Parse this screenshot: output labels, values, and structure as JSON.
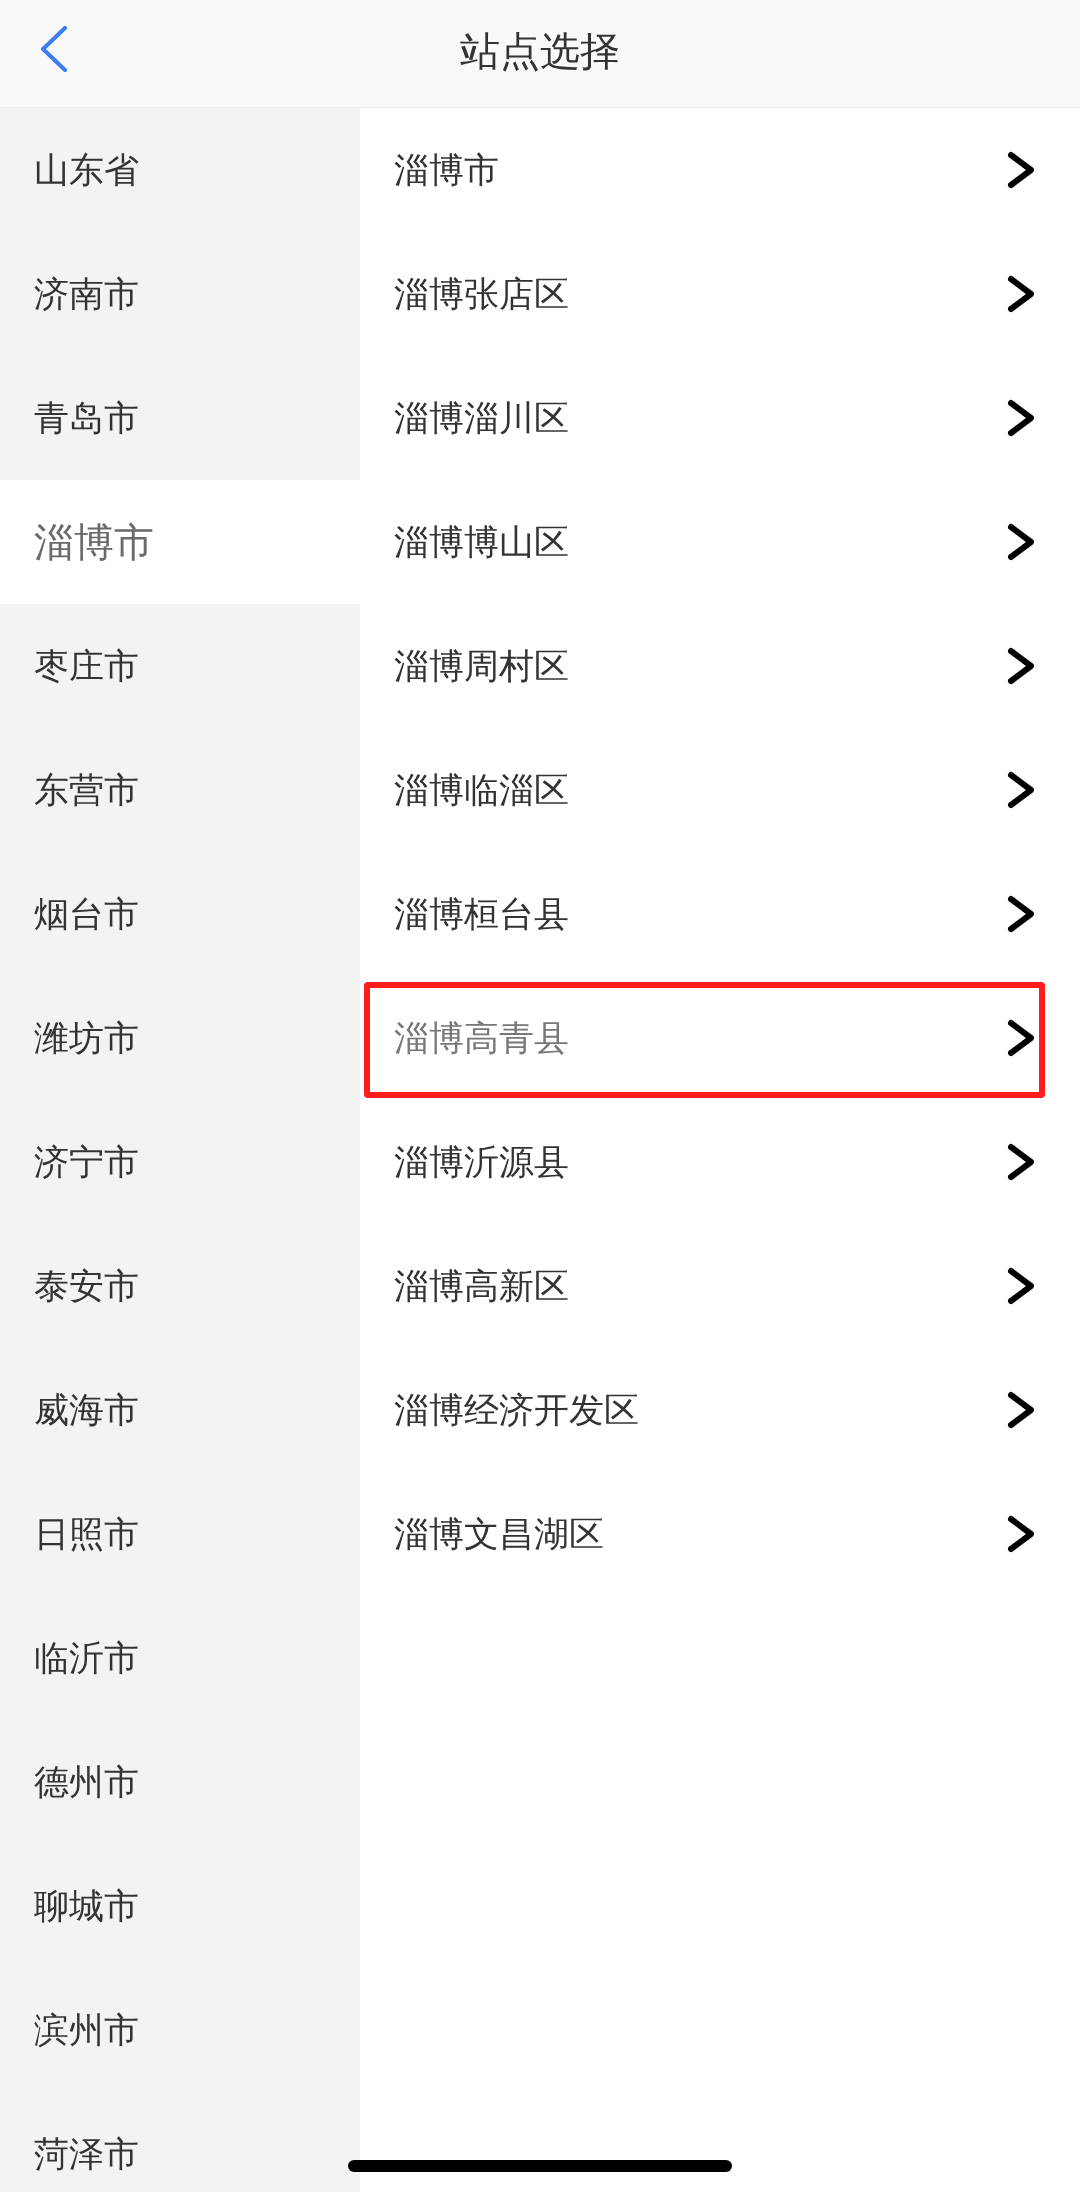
{
  "header": {
    "title": "站点选择"
  },
  "provinces": [
    {
      "label": "山东省",
      "selected": false
    },
    {
      "label": "济南市",
      "selected": false
    },
    {
      "label": "青岛市",
      "selected": false
    },
    {
      "label": "淄博市",
      "selected": true
    },
    {
      "label": "枣庄市",
      "selected": false
    },
    {
      "label": "东营市",
      "selected": false
    },
    {
      "label": "烟台市",
      "selected": false
    },
    {
      "label": "潍坊市",
      "selected": false
    },
    {
      "label": "济宁市",
      "selected": false
    },
    {
      "label": "泰安市",
      "selected": false
    },
    {
      "label": "威海市",
      "selected": false
    },
    {
      "label": "日照市",
      "selected": false
    },
    {
      "label": "临沂市",
      "selected": false
    },
    {
      "label": "德州市",
      "selected": false
    },
    {
      "label": "聊城市",
      "selected": false
    },
    {
      "label": "滨州市",
      "selected": false
    },
    {
      "label": "菏泽市",
      "selected": false
    }
  ],
  "stations": [
    {
      "label": "淄博市",
      "selected": false,
      "highlighted": false
    },
    {
      "label": "淄博张店区",
      "selected": false,
      "highlighted": false
    },
    {
      "label": "淄博淄川区",
      "selected": false,
      "highlighted": false
    },
    {
      "label": "淄博博山区",
      "selected": false,
      "highlighted": false
    },
    {
      "label": "淄博周村区",
      "selected": false,
      "highlighted": false
    },
    {
      "label": "淄博临淄区",
      "selected": false,
      "highlighted": false
    },
    {
      "label": "淄博桓台县",
      "selected": false,
      "highlighted": false
    },
    {
      "label": "淄博高青县",
      "selected": true,
      "highlighted": true
    },
    {
      "label": "淄博沂源县",
      "selected": false,
      "highlighted": false
    },
    {
      "label": "淄博高新区",
      "selected": false,
      "highlighted": false
    },
    {
      "label": "淄博经济开发区",
      "selected": false,
      "highlighted": false
    },
    {
      "label": "淄博文昌湖区",
      "selected": false,
      "highlighted": false
    }
  ]
}
